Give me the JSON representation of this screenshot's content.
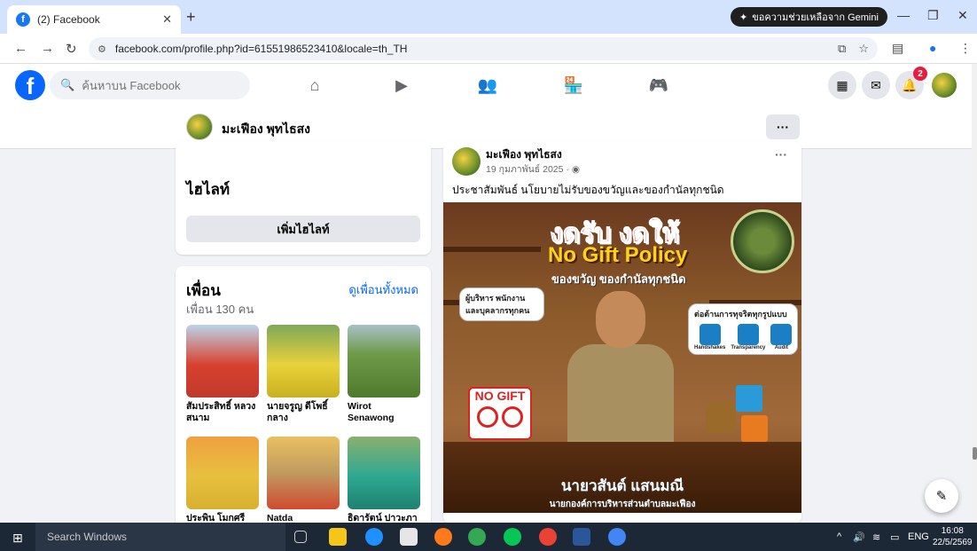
{
  "browser": {
    "tab_title": "(2) Facebook",
    "url": "facebook.com/profile.php?id=61551986523410&locale=th_TH",
    "gemini_label": "ขอความช่วยเหลือจาก Gemini"
  },
  "fb": {
    "search_placeholder": "ค้นหาบน Facebook",
    "notifications_count": "2"
  },
  "profile": {
    "name": "มะเฟือง พุทไธสง"
  },
  "highlights": {
    "title": "ไฮไลท์",
    "add_button": "เพิ่มไฮไลท์"
  },
  "friends": {
    "title": "เพื่อน",
    "see_all": "ดูเพื่อนทั้งหมด",
    "count": "เพื่อน 130 คน",
    "items": [
      {
        "name": "สัมประสิทธิ์ หลวงสนาม"
      },
      {
        "name": "นายจรูญ ดีโพธิ์กลาง"
      },
      {
        "name": "Wirot Senawong"
      },
      {
        "name": "ประพิน โมกศรี"
      },
      {
        "name": "Natda"
      },
      {
        "name": "ธิดารัตน์ ปาวะภา"
      }
    ]
  },
  "post": {
    "author": "มะเฟือง พุทไธสง",
    "date": "19 กุมภาพันธ์ 2025 · ",
    "text": "ประชาสัมพันธ์ นโยบายไม่รับของขวัญและของกำนัลทุกชนิด",
    "image": {
      "headline": "งดรับ งดให้",
      "policy": "No Gift Policy",
      "subhead": "ของขวัญ ของกำนัลทุกชนิด",
      "bubble_left": "ผู้บริหาร พนักงาน และบุคลากรทุกคน",
      "bubble_right": "ต่อต้านการทุจริตทุกรูปแบบ",
      "icons": [
        "Handshakes",
        "Transparency",
        "Audit"
      ],
      "no_gift": "NO GIFT",
      "person_name": "นายวสันต์ แสนมณี",
      "person_title": "นายกองค์การบริหารส่วนตำบลมะเฟือง"
    }
  },
  "taskbar": {
    "search": "Search Windows",
    "lang": "ENG",
    "time": "16:08",
    "date": "22/5/2569"
  }
}
